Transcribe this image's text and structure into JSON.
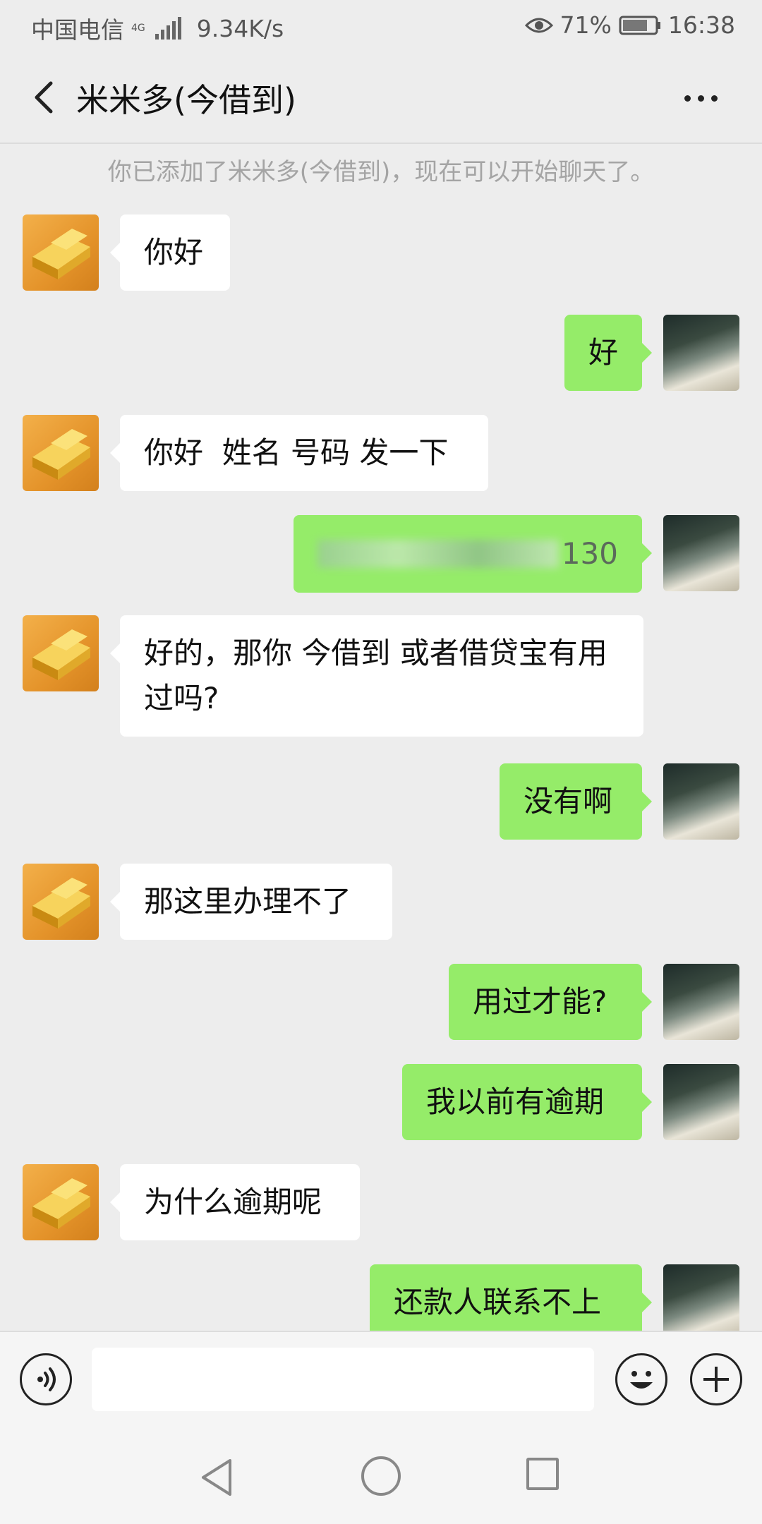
{
  "status": {
    "carrier": "中国电信",
    "network": "4G",
    "speed": "9.34K/s",
    "battery": "71%",
    "time": "16:38"
  },
  "header": {
    "title": "米米多(今借到)"
  },
  "system_message": "你已添加了米米多(今借到)，现在可以开始聊天了。",
  "messages": [
    {
      "side": "left",
      "text": "你好"
    },
    {
      "side": "right",
      "text": "好"
    },
    {
      "side": "left",
      "text": "你好  姓名 号码 发一下"
    },
    {
      "side": "right",
      "text": "130",
      "blurred": true
    },
    {
      "side": "left",
      "text": "好的，那你 今借到 或者借贷宝有用过吗?"
    },
    {
      "side": "right",
      "text": "没有啊"
    },
    {
      "side": "left",
      "text": "那这里办理不了"
    },
    {
      "side": "right",
      "text": "用过才能?"
    },
    {
      "side": "right",
      "text": "我以前有逾期"
    },
    {
      "side": "left",
      "text": "为什么逾期呢"
    },
    {
      "side": "right",
      "text": "还款人联系不上"
    }
  ],
  "colors": {
    "chat_bg": "#ededed",
    "my_bubble": "#95ec69",
    "their_bubble": "#ffffff"
  },
  "icons": {
    "back": "chevron-left-icon",
    "more": "more-dots-icon",
    "voice": "voice-icon",
    "emoji": "emoji-icon",
    "plus": "plus-icon"
  }
}
